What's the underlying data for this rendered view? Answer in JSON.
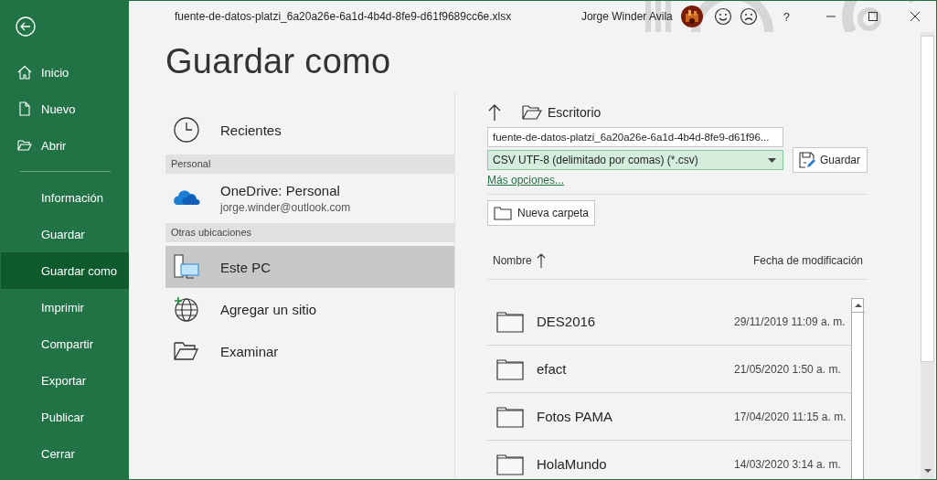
{
  "window": {
    "title": "fuente-de-datos-platzi_6a20a26e-6a1d-4b4d-8fe9-d61f9689cc6e.xlsx",
    "user": "Jorge Winder Avila",
    "help": "?"
  },
  "sidebar": {
    "top_items": [
      {
        "label": "Inicio",
        "kind": "home"
      },
      {
        "label": "Nuevo",
        "kind": "new"
      },
      {
        "label": "Abrir",
        "kind": "open"
      }
    ],
    "items": [
      {
        "label": "Información",
        "selected": false
      },
      {
        "label": "Guardar",
        "selected": false
      },
      {
        "label": "Guardar como",
        "selected": true
      },
      {
        "label": "Imprimir",
        "selected": false
      },
      {
        "label": "Compartir",
        "selected": false
      },
      {
        "label": "Exportar",
        "selected": false
      },
      {
        "label": "Publicar",
        "selected": false
      },
      {
        "label": "Cerrar",
        "selected": false
      }
    ]
  },
  "heading": "Guardar como",
  "locations": [
    {
      "kind": "recent",
      "label": "Recientes",
      "selected": false
    },
    {
      "kind": "header",
      "label": "Personal"
    },
    {
      "kind": "cloud",
      "label": "OneDrive: Personal",
      "detail": "jorge.winder@outlook.com",
      "selected": false
    },
    {
      "kind": "header",
      "label": "Otras ubicaciones"
    },
    {
      "kind": "pc",
      "label": "Este PC",
      "selected": true
    },
    {
      "kind": "site",
      "label": "Agregar un sitio",
      "selected": false
    },
    {
      "kind": "browse",
      "label": "Examinar",
      "selected": false
    }
  ],
  "save_panel": {
    "folder": "Escritorio",
    "file_name": "fuente-de-datos-platzi_6a20a26e-6a1d-4b4d-8fe9-d61f96...",
    "file_type": "CSV UTF-8 (delimitado por comas) (*.csv)",
    "save_button": "Guardar",
    "more_options": "Más opciones...",
    "new_folder": "Nueva carpeta"
  },
  "table": {
    "columns": [
      "Nombre",
      "Fecha de modificación"
    ],
    "rows": [
      {
        "name": "DES2016",
        "modified": "29/11/2019 11:09 a. m."
      },
      {
        "name": "efact",
        "modified": "21/05/2020 1:50 a. m."
      },
      {
        "name": "Fotos PAMA",
        "modified": "17/04/2020 11:15 a. m."
      },
      {
        "name": "HolaMundo",
        "modified": "14/03/2020 3:14 a. m."
      }
    ]
  }
}
